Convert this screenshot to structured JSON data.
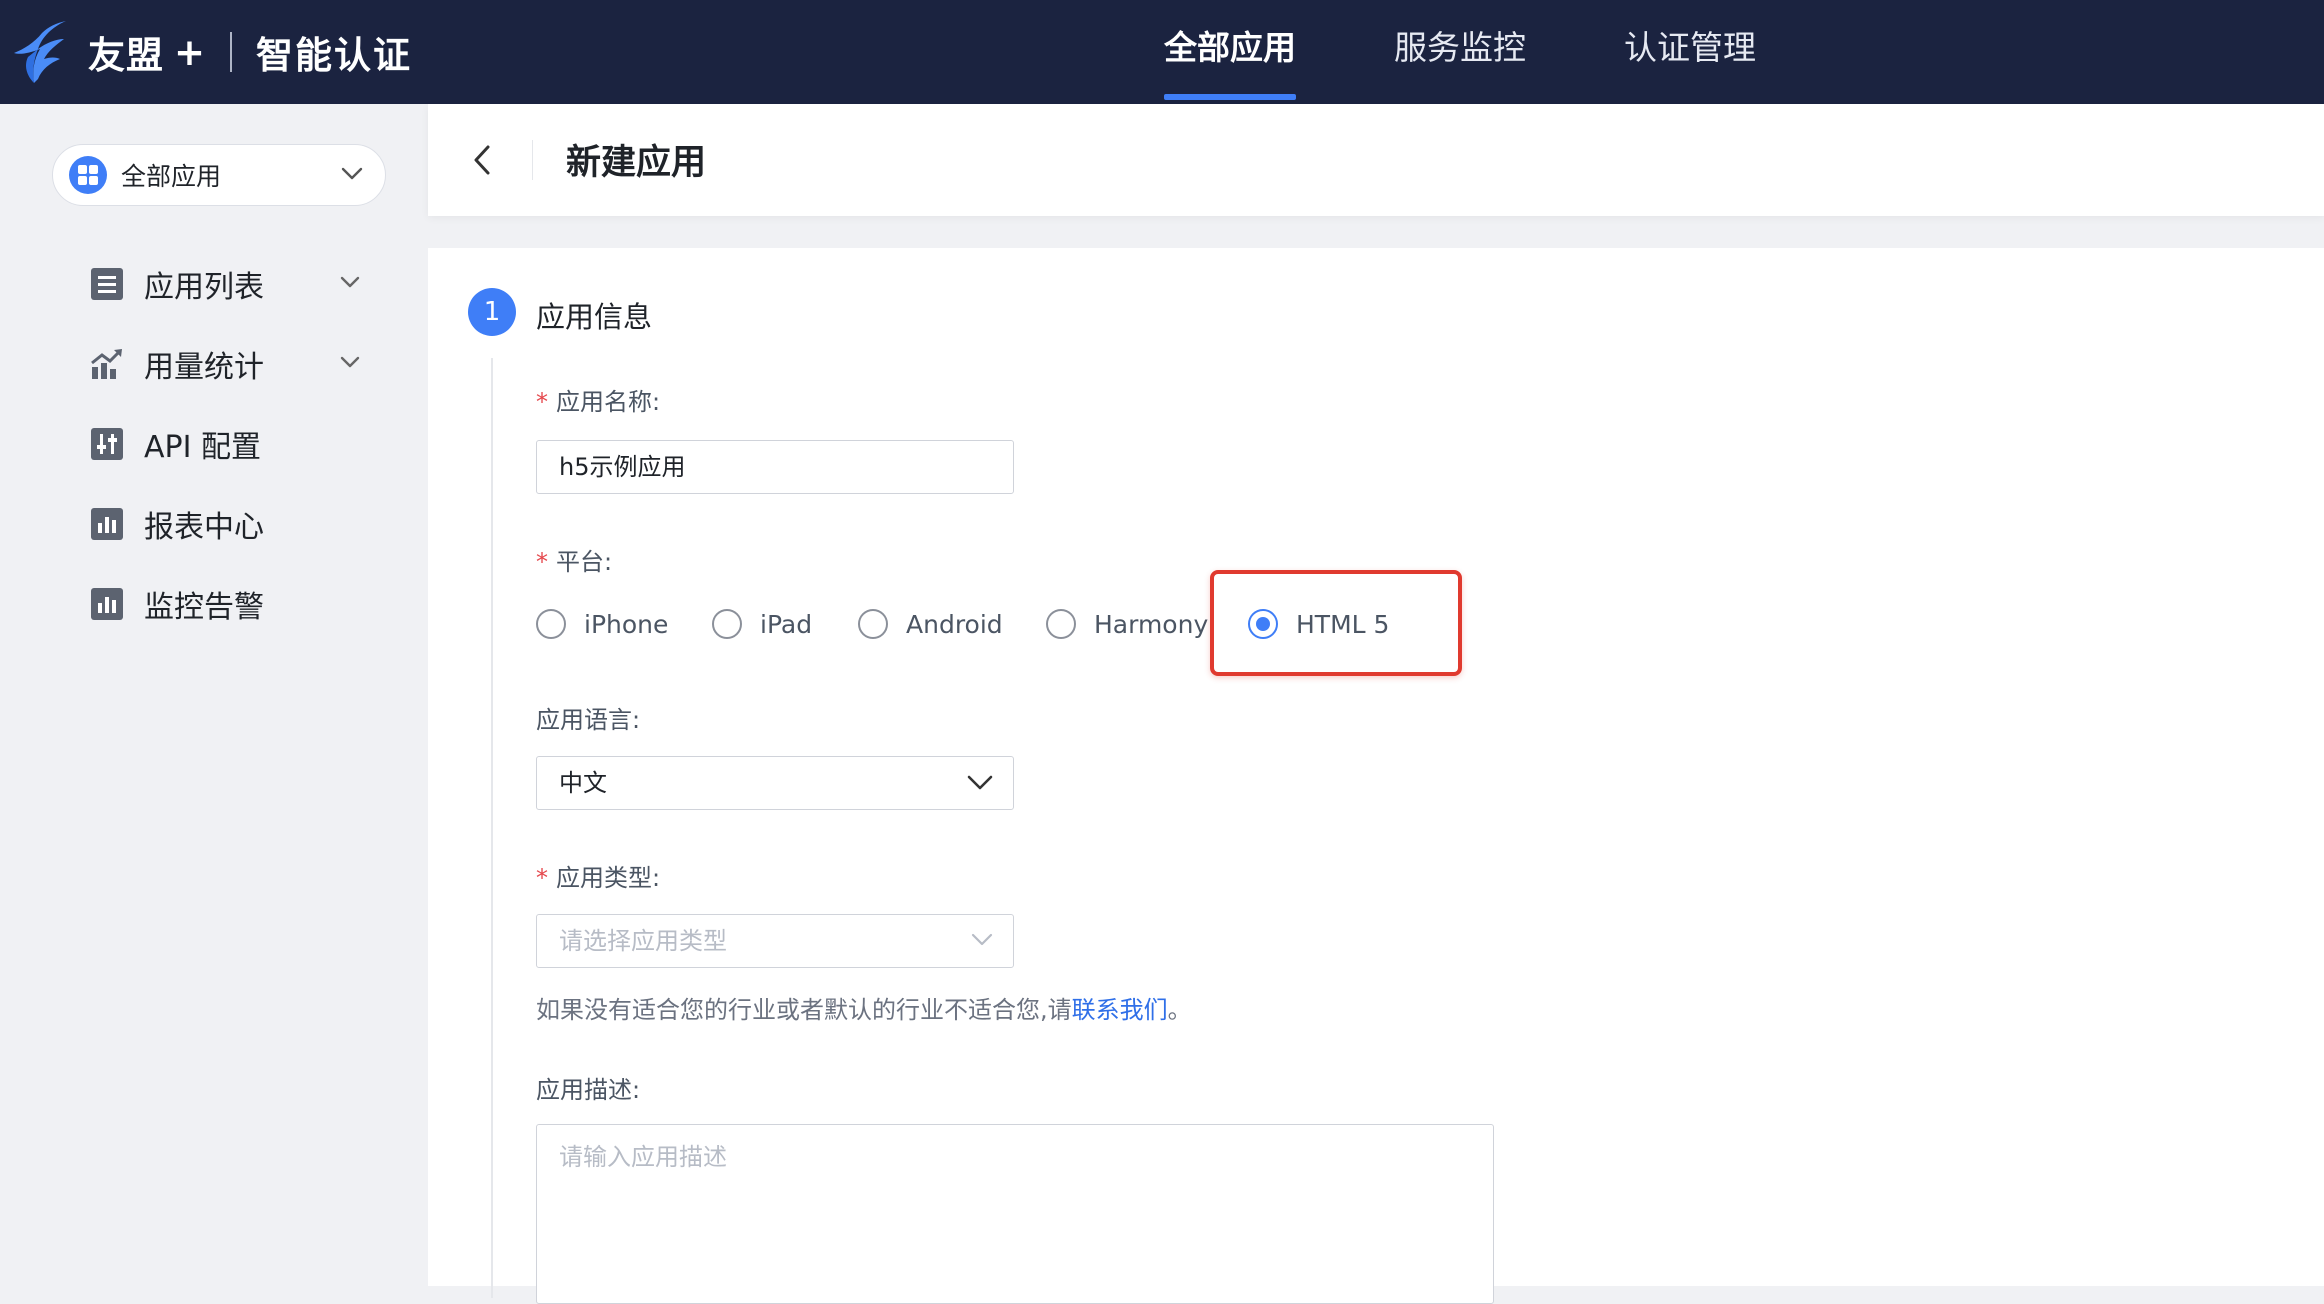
{
  "brand": {
    "name": "友盟",
    "plus": "+",
    "product": "智能认证"
  },
  "topnav": [
    {
      "label": "全部应用",
      "active": true
    },
    {
      "label": "服务监控",
      "active": false
    },
    {
      "label": "认证管理",
      "active": false
    }
  ],
  "sidebar": {
    "app_select": {
      "label": "全部应用",
      "icon": "grid-icon"
    },
    "items": [
      {
        "label": "应用列表",
        "icon": "list-icon",
        "expandable": true
      },
      {
        "label": "用量统计",
        "icon": "trend-chart-icon",
        "expandable": true
      },
      {
        "label": "API 配置",
        "icon": "api-config-icon",
        "expandable": false
      },
      {
        "label": "报表中心",
        "icon": "bar-chart-icon",
        "expandable": false
      },
      {
        "label": "监控告警",
        "icon": "bar-chart-icon",
        "expandable": false
      }
    ]
  },
  "header": {
    "title": "新建应用"
  },
  "form": {
    "step": {
      "number": "1",
      "title": "应用信息"
    },
    "app_name": {
      "label": "应用名称:",
      "required_mark": "*",
      "value": "h5示例应用"
    },
    "platform": {
      "label": "平台:",
      "required_mark": "*",
      "options": [
        {
          "label": "iPhone",
          "checked": false
        },
        {
          "label": "iPad",
          "checked": false
        },
        {
          "label": "Android",
          "checked": false
        },
        {
          "label": "Harmony",
          "checked": false
        },
        {
          "label": "HTML 5",
          "checked": true
        }
      ]
    },
    "language": {
      "label": "应用语言:",
      "value": "中文"
    },
    "app_type": {
      "label": "应用类型:",
      "required_mark": "*",
      "placeholder": "请选择应用类型"
    },
    "hint": {
      "text": "如果没有适合您的行业或者默认的行业不适合您,请",
      "link": "联系我们",
      "end": "。"
    },
    "description": {
      "label": "应用描述:",
      "placeholder": "请输入应用描述"
    }
  },
  "colors": {
    "topbar": "#1b2340",
    "accent": "#3f7ef7",
    "highlight": "#e03a2f",
    "required": "#e5484d"
  }
}
